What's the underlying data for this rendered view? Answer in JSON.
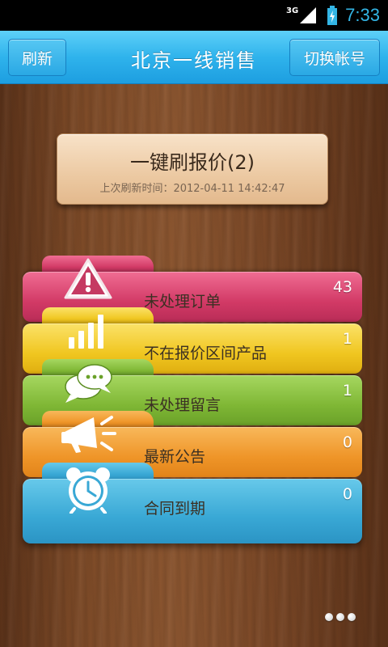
{
  "status_bar": {
    "network": "3G",
    "time": "7:33",
    "icons": [
      "signal-icon",
      "battery-charging-icon"
    ]
  },
  "title_bar": {
    "left_button": "刷新",
    "title": "北京一线销售",
    "right_button": "切换帐号"
  },
  "quote_button": {
    "title": "一键刷报价(2)",
    "last_refresh_label": "上次刷新时间：",
    "last_refresh_time": "2012-04-11 14:42:47"
  },
  "folders": [
    {
      "label": "未处理订单",
      "count": "43",
      "icon": "warning-icon",
      "color": "#d23a66"
    },
    {
      "label": "不在报价区间产品",
      "count": "1",
      "icon": "bar-chart-icon",
      "color": "#f0c620"
    },
    {
      "label": "未处理留言",
      "count": "1",
      "icon": "chat-bubbles-icon",
      "color": "#7fb735"
    },
    {
      "label": "最新公告",
      "count": "0",
      "icon": "megaphone-icon",
      "color": "#ef9528"
    },
    {
      "label": "合同到期",
      "count": "0",
      "icon": "alarm-clock-icon",
      "color": "#39a8d5"
    }
  ],
  "pager": {
    "pages": 3
  }
}
